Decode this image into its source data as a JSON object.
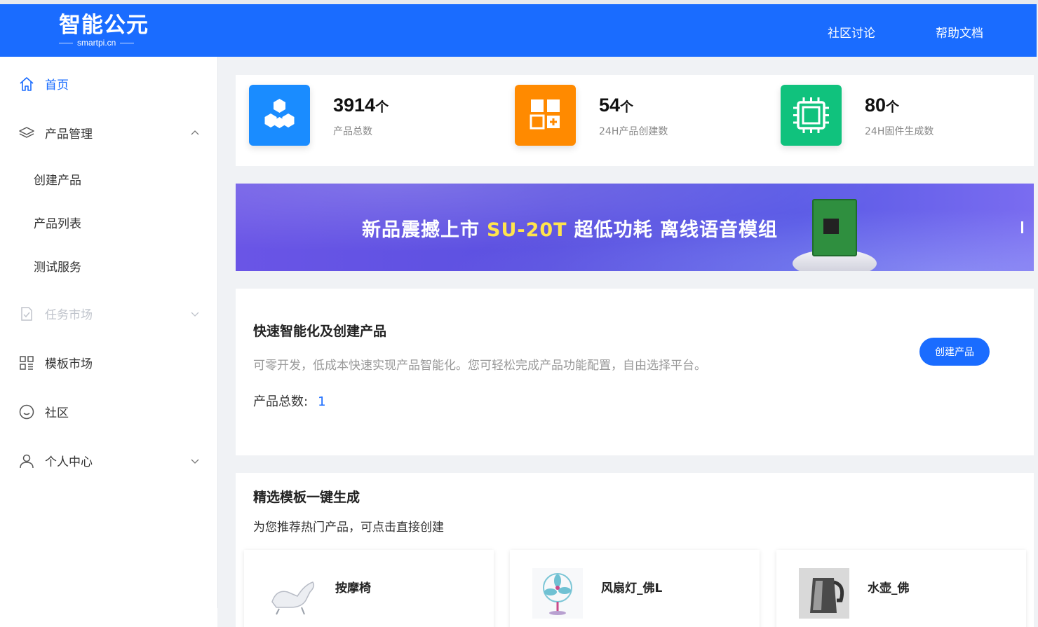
{
  "header": {
    "logo_text": "智能公元",
    "logo_domain": "smartpi.cn",
    "nav": [
      {
        "label": "社区讨论"
      },
      {
        "label": "帮助文档"
      }
    ]
  },
  "sidebar": {
    "home": "首页",
    "product_mgmt": "产品管理",
    "sub_items": [
      "创建产品",
      "产品列表",
      "测试服务"
    ],
    "task_market": "任务市场",
    "template_market": "模板市场",
    "community": "社区",
    "personal": "个人中心"
  },
  "stats": [
    {
      "value": "3914",
      "unit": "个",
      "label": "产品总数",
      "color": "#1a8cff",
      "icon": "cubes-icon"
    },
    {
      "value": "54",
      "unit": "个",
      "label": "24H产品创建数",
      "color": "#ff8a00",
      "icon": "add-grid-icon"
    },
    {
      "value": "80",
      "unit": "个",
      "label": "24H固件生成数",
      "color": "#10c27d",
      "icon": "chip-icon"
    }
  ],
  "banner": {
    "text_before": "新品震撼上市",
    "model": "SU-20T",
    "text_after": "超低功耗  离线语音模组"
  },
  "quick": {
    "title": "快速智能化及创建产品",
    "desc": "可零开发，低成本快速实现产品智能化。您可轻松完成产品功能配置，自由选择平台。",
    "count_label": "产品总数:",
    "count_value": "1",
    "button": "创建产品"
  },
  "templates": {
    "title": "精选模板一键生成",
    "subtitle": "为您推荐热门产品，可点击直接创建",
    "items": [
      {
        "name": "按摩椅"
      },
      {
        "name": "风扇灯_佛L"
      },
      {
        "name": "水壶_佛"
      }
    ]
  },
  "colors": {
    "primary": "#1a6cff"
  }
}
